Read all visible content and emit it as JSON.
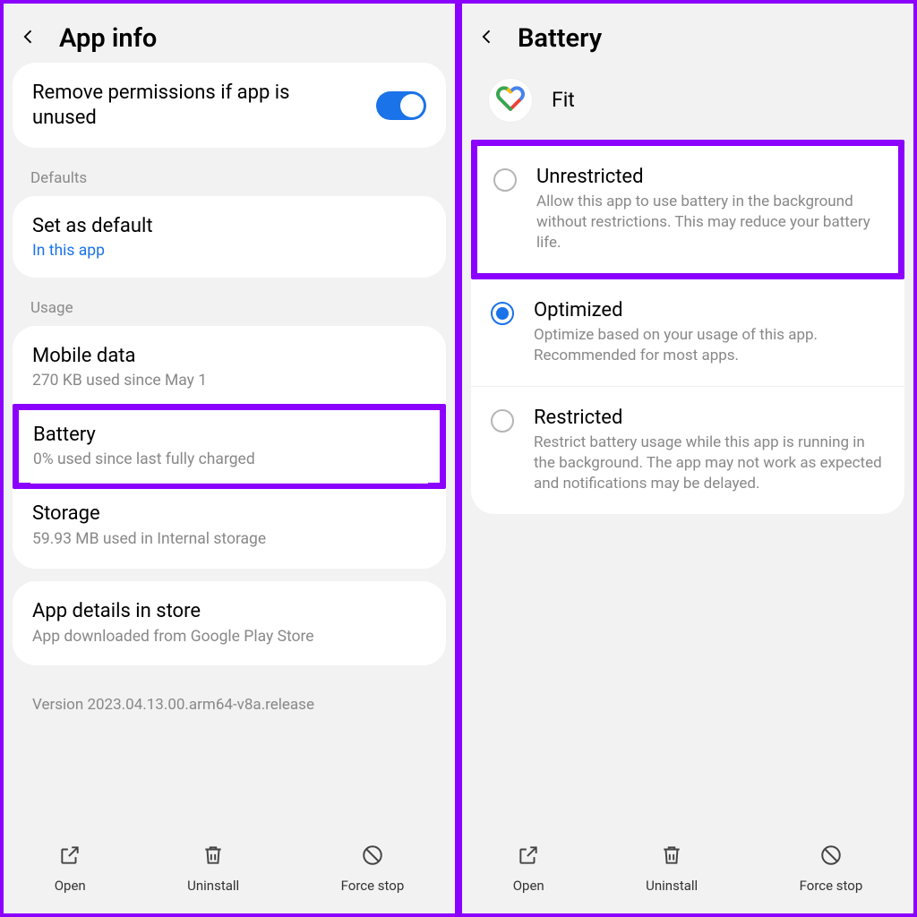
{
  "left": {
    "title": "App info",
    "toggle_row": "Remove permissions if app is unused",
    "section_defaults": "Defaults",
    "defaults_row": {
      "title": "Set as default",
      "link": "In this app"
    },
    "section_usage": "Usage",
    "mobile_data": {
      "title": "Mobile data",
      "sub": "270 KB used since May 1"
    },
    "battery": {
      "title": "Battery",
      "sub": "0% used since last fully charged"
    },
    "storage": {
      "title": "Storage",
      "sub": "59.93 MB used in Internal storage"
    },
    "app_details": {
      "title": "App details in store",
      "sub": "App downloaded from Google Play Store"
    },
    "version": "Version 2023.04.13.00.arm64-v8a.release"
  },
  "right": {
    "title": "Battery",
    "app_name": "Fit",
    "options": {
      "unrestricted": {
        "title": "Unrestricted",
        "desc": "Allow this app to use battery in the background without restrictions. This may reduce your battery life."
      },
      "optimized": {
        "title": "Optimized",
        "desc": "Optimize based on your usage of this app. Recommended for most apps."
      },
      "restricted": {
        "title": "Restricted",
        "desc": "Restrict battery usage while this app is running in the background. The app may not work as expected and notifications may be delayed."
      }
    }
  },
  "bottom": {
    "open": "Open",
    "uninstall": "Uninstall",
    "force_stop": "Force stop"
  }
}
